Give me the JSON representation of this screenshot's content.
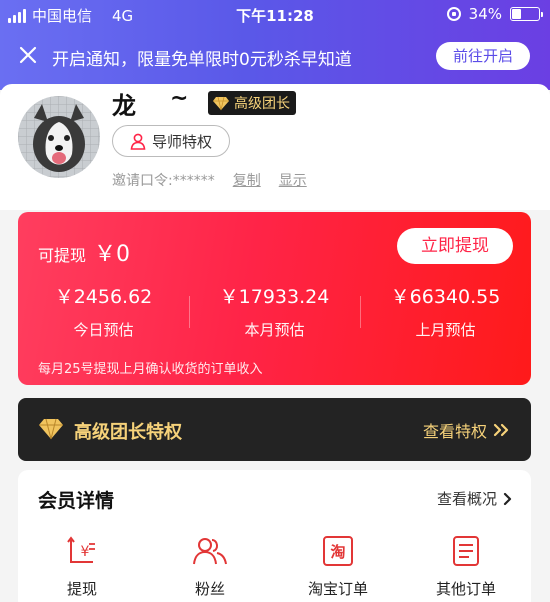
{
  "status_bar": {
    "carrier": "中国电信",
    "network": "4G",
    "time": "下午11:28",
    "battery": "34%",
    "battery_level": 0.34
  },
  "notice": {
    "text": "开启通知，限量免单限时0元秒杀早知道",
    "button": "前往开启"
  },
  "profile": {
    "name": "龙",
    "name_suffix": "~",
    "badge": "高级团长",
    "mentor_button": "导师特权",
    "invite_label": "邀请口令:******",
    "copy_link": "复制",
    "show_link": "显示"
  },
  "earnings": {
    "withdrawable_label": "可提现",
    "withdrawable_amount": "￥0",
    "withdraw_button": "立即提现",
    "columns": [
      {
        "value": "￥2456.62",
        "label": "今日预估"
      },
      {
        "value": "￥17933.24",
        "label": "本月预估"
      },
      {
        "value": "￥66340.55",
        "label": "上月预估"
      }
    ],
    "note": "每月25号提现上月确认收货的订单收入"
  },
  "privilege": {
    "title": "高级团长特权",
    "link": "查看特权"
  },
  "member": {
    "title": "会员详情",
    "link": "查看概况",
    "items": [
      {
        "label": "提现",
        "icon": "withdraw-icon"
      },
      {
        "label": "粉丝",
        "icon": "fans-icon"
      },
      {
        "label": "淘宝订单",
        "icon": "taobao-order-icon"
      },
      {
        "label": "其他订单",
        "icon": "other-order-icon"
      }
    ]
  },
  "colors": {
    "accent_red": "#ff2447",
    "banner_purple": "#5a58e8",
    "gold": "#f6d27a"
  }
}
